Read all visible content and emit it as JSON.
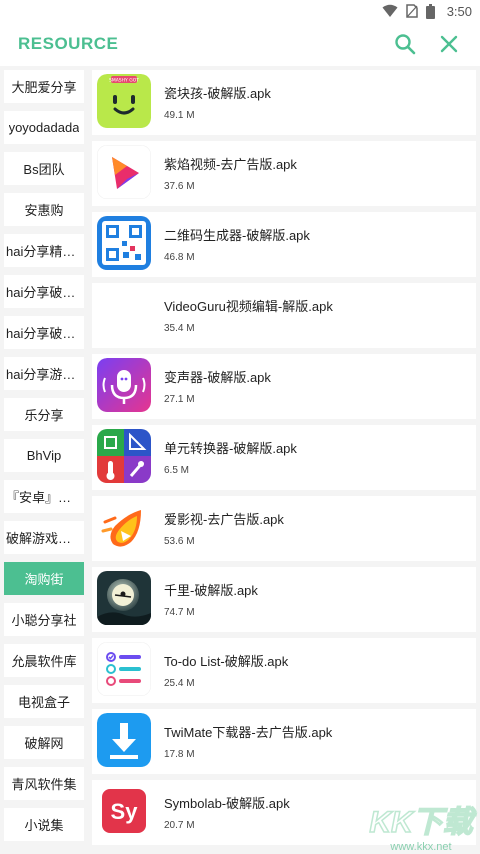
{
  "status_bar": {
    "time": "3:50"
  },
  "header": {
    "title": "RESOURCE",
    "search_icon": "search-icon",
    "close_icon": "close-icon",
    "accent": "#4cbf91"
  },
  "sidebar": {
    "active_color": "#4cbf91",
    "items": [
      {
        "label": "大肥爱分享",
        "active": false
      },
      {
        "label": "yoyodadada",
        "active": false
      },
      {
        "label": "Bs团队",
        "active": false
      },
      {
        "label": "安惠购",
        "active": false
      },
      {
        "label": "hai分享精选…",
        "active": false
      },
      {
        "label": "hai分享破解…",
        "active": false
      },
      {
        "label": "hai分享破解…",
        "active": false
      },
      {
        "label": "hai分享游戏…",
        "active": false
      },
      {
        "label": "乐分享",
        "active": false
      },
      {
        "label": "BhVip",
        "active": false
      },
      {
        "label": "『安卓』破…",
        "active": false
      },
      {
        "label": "破解游戏合集",
        "active": false
      },
      {
        "label": "淘购街",
        "active": true
      },
      {
        "label": "小聪分享社",
        "active": false
      },
      {
        "label": "允晨软件库",
        "active": false
      },
      {
        "label": "电视盒子",
        "active": false
      },
      {
        "label": "破解网",
        "active": false
      },
      {
        "label": "青风软件集",
        "active": false
      },
      {
        "label": "小说集",
        "active": false
      }
    ]
  },
  "apps": [
    {
      "name": "瓷块孩-破解版.apk",
      "size": "49.1 M",
      "icon": "smiley-block-icon",
      "icon_label": "SMASHY GOT"
    },
    {
      "name": "紫焰视频-去广告版.apk",
      "size": "37.6 M",
      "icon": "play-flame-icon"
    },
    {
      "name": "二维码生成器-破解版.apk",
      "size": "46.8 M",
      "icon": "qr-code-icon"
    },
    {
      "name": "VideoGuru视频编辑-解版.apk",
      "size": "35.4 M",
      "icon": "none"
    },
    {
      "name": "变声器-破解版.apk",
      "size": "27.1 M",
      "icon": "microphone-icon"
    },
    {
      "name": "单元转换器-破解版.apk",
      "size": "6.5 M",
      "icon": "unit-converter-icon"
    },
    {
      "name": "爱影视-去广告版.apk",
      "size": "53.6 M",
      "icon": "flame-play-icon"
    },
    {
      "name": "千里-破解版.apk",
      "size": "74.7 M",
      "icon": "moon-witch-icon"
    },
    {
      "name": "To-do List-破解版.apk",
      "size": "25.4 M",
      "icon": "todo-list-icon"
    },
    {
      "name": "TwiMate下载器-去广告版.apk",
      "size": "17.8 M",
      "icon": "download-arrow-icon"
    },
    {
      "name": "Symbolab-破解版.apk",
      "size": "20.7 M",
      "icon": "symbolab-icon",
      "icon_label": "Sy"
    }
  ],
  "watermark": {
    "text": "KK下载",
    "url_text": "www.kkx.net"
  }
}
